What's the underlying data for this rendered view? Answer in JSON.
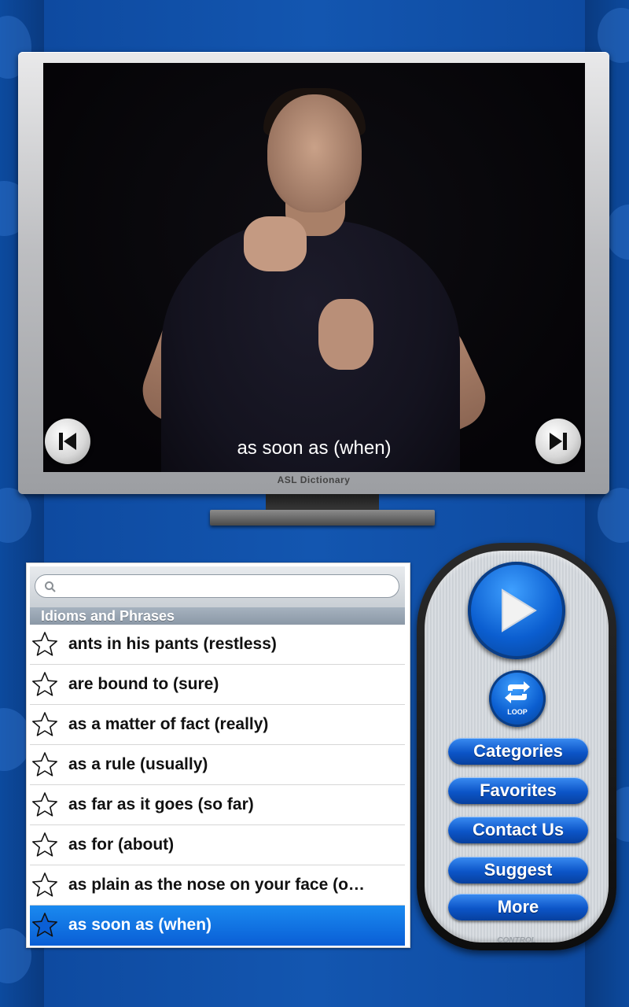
{
  "video": {
    "caption": "as soon as (when)",
    "tv_label": "ASL Dictionary",
    "prev_icon": "skip-previous-icon",
    "next_icon": "skip-next-icon"
  },
  "list": {
    "search_placeholder": "",
    "section_title": "Idioms and Phrases",
    "items": [
      {
        "label": "ants in his pants (restless)",
        "selected": false
      },
      {
        "label": "are bound to (sure)",
        "selected": false
      },
      {
        "label": "as a matter of fact (really)",
        "selected": false
      },
      {
        "label": "as a rule (usually)",
        "selected": false
      },
      {
        "label": "as far as it goes (so far)",
        "selected": false
      },
      {
        "label": "as for (about)",
        "selected": false
      },
      {
        "label": "as plain as the nose on your face (o…",
        "selected": false
      },
      {
        "label": "as soon as (when)",
        "selected": true
      }
    ]
  },
  "remote": {
    "loop_label": "LOOP",
    "buttons": {
      "categories": "Categories",
      "favorites": "Favorites",
      "contact": "Contact Us",
      "suggest": "Suggest",
      "more": "More"
    },
    "control_label": "CONTROL"
  },
  "colors": {
    "accent": "#0b5ed0",
    "selected_row": "#1a8af0",
    "background": "#0e4aa0"
  }
}
